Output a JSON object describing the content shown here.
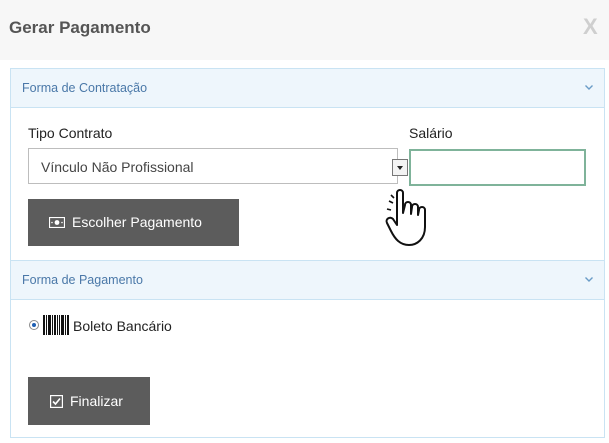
{
  "dialog": {
    "title": "Gerar Pagamento",
    "close_label": "X"
  },
  "contratacao": {
    "section_title": "Forma de Contratação",
    "tipo_contrato_label": "Tipo Contrato",
    "tipo_contrato_value": "Vínculo Não Profissional",
    "salario_label": "Salário",
    "salario_value": "",
    "escolher_button": "Escolher Pagamento"
  },
  "pagamento": {
    "section_title": "Forma de Pagamento",
    "option_label": "Boleto Bancário",
    "option_selected": true,
    "finalizar_button": "Finalizar"
  },
  "icons": {
    "section_toggle": "chevron-down-icon",
    "escolher": "money-icon",
    "option": "barcode-icon",
    "finalizar": "check-square-icon",
    "cursor": "hand-pointer-icon"
  },
  "colors": {
    "section_bg": "#eef6fc",
    "section_border": "#c9e3f3",
    "section_title": "#4a78a8",
    "button_bg": "#5c5c5c",
    "input_focus_border": "#7fb39a",
    "radio_selected": "#1e5fb3"
  }
}
